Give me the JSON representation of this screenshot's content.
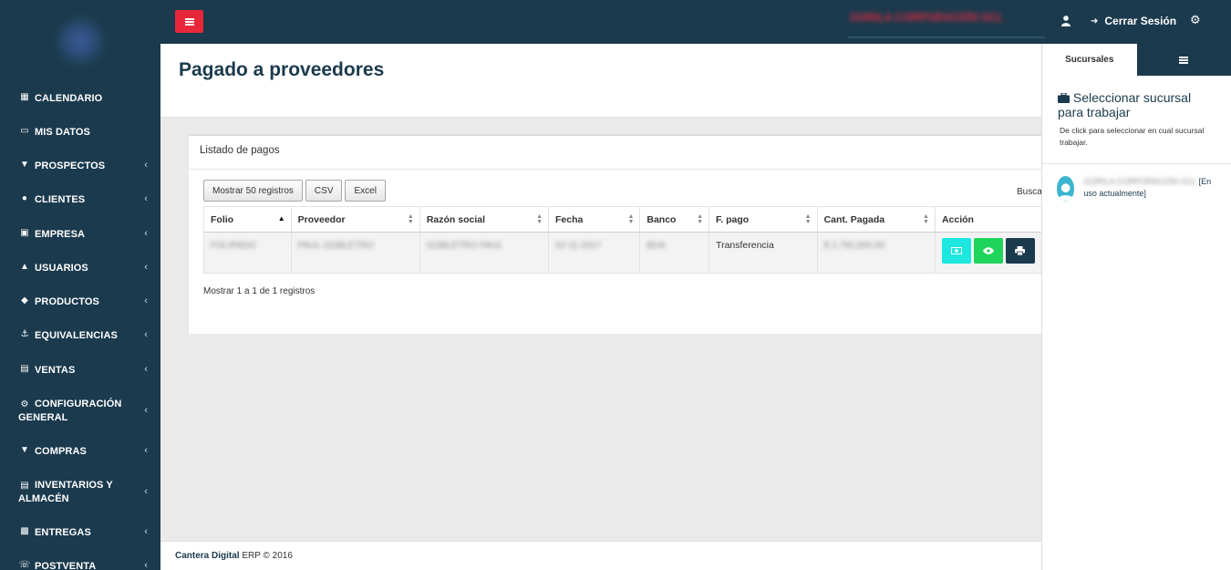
{
  "header": {
    "company_name": "GORILA CORPORACIÓN SCL",
    "logout_label": "Cerrar Sesión"
  },
  "sidebar": {
    "items": [
      {
        "label": "CALENDARIO",
        "icon": "calendar-icon",
        "has_children": false
      },
      {
        "label": "MIS DATOS",
        "icon": "laptop-icon",
        "has_children": false
      },
      {
        "label": "PROSPECTOS",
        "icon": "filter-icon",
        "has_children": true
      },
      {
        "label": "CLIENTES",
        "icon": "users-icon",
        "has_children": true
      },
      {
        "label": "EMPRESA",
        "icon": "building-icon",
        "has_children": true
      },
      {
        "label": "USUARIOS",
        "icon": "user-icon",
        "has_children": true
      },
      {
        "label": "PRODUCTOS",
        "icon": "cube-icon",
        "has_children": true
      },
      {
        "label": "EQUIVALENCIAS",
        "icon": "anchor-icon",
        "has_children": true
      },
      {
        "label": "VENTAS",
        "icon": "money-icon",
        "has_children": true
      },
      {
        "label": "CONFIGURACIÓN GENERAL",
        "icon": "gear-icon",
        "has_children": true
      },
      {
        "label": "COMPRAS",
        "icon": "cart-icon",
        "has_children": true
      },
      {
        "label": "INVENTARIOS Y ALMACÉN",
        "icon": "box-icon",
        "has_children": true
      },
      {
        "label": "ENTREGAS",
        "icon": "car-icon",
        "has_children": true
      },
      {
        "label": "POSTVENTA",
        "icon": "phone-icon",
        "has_children": true
      }
    ]
  },
  "page": {
    "title": "Pagado a proveedores"
  },
  "panel": {
    "heading": "Listado de pagos",
    "buttons": [
      "Mostrar 50 registros",
      "CSV",
      "Excel"
    ],
    "search_label": "Busca",
    "columns": [
      "Folio",
      "Proveedor",
      "Razón social",
      "Fecha",
      "Banco",
      "F. pago",
      "Cant. Pagada",
      "Acción"
    ],
    "rows": [
      {
        "folio": "FOLIPADO",
        "proveedor": "PAUL GOBLETRO",
        "razon_social": "GOBLETRO PAUL",
        "fecha": "02-11-2017",
        "banco": "BHA",
        "f_pago": "Transferencia",
        "cant_pagada": "$ 2,750,000.00"
      }
    ],
    "info": "Mostrar 1 a 1 de 1 registros"
  },
  "footer": {
    "brand": "Cantera Digital",
    "rest": " ERP © 2016"
  },
  "right_panel": {
    "tab_label": "Sucursales",
    "title": "Seleccionar sucursal para trabajar",
    "subtitle": "De click para seleccionar en cual sucursal trabajar.",
    "branch_name": "GORILA CORPORACIÓN SCL",
    "branch_status": "[En uso actualmente]"
  },
  "colors": {
    "dark": "#1b3a4d",
    "accent_red": "#e8273a",
    "cyan": "#1ce8e0",
    "green": "#1ed45a"
  }
}
